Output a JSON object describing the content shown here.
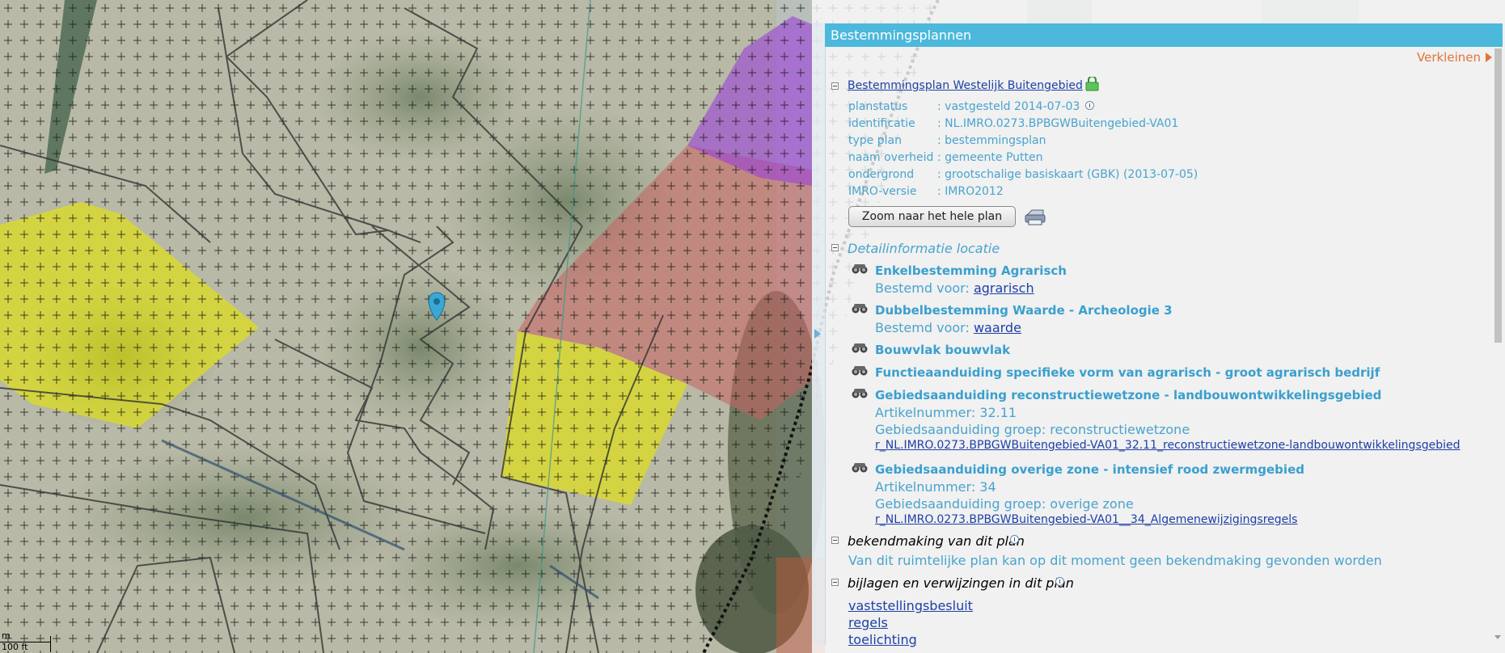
{
  "panel": {
    "title": "Bestemmingsplannen",
    "shrink_label": "Verkleinen"
  },
  "plan": {
    "name": "Bestemmingsplan Westelijk Buitengebied",
    "props": [
      {
        "label": "planstatus",
        "value": ": vastgesteld 2014-07-03"
      },
      {
        "label": "identificatie",
        "value": ": NL.IMRO.0273.BPBGWBuitengebied-VA01"
      },
      {
        "label": "type plan",
        "value": ": bestemmingsplan"
      },
      {
        "label": "naam overheid",
        "value": ": gemeente Putten"
      },
      {
        "label": "ondergrond",
        "value": ": grootschalige basiskaart (GBK) (2013-07-05)"
      },
      {
        "label": "IMRO-versie",
        "value": ": IMRO2012"
      }
    ],
    "zoom_button": "Zoom naar het hele plan"
  },
  "detail": {
    "heading": "Detailinformatie locatie",
    "items": [
      {
        "title": "Enkelbestemming Agrarisch",
        "prefix": "Bestemd voor:",
        "link": "agrarisch"
      },
      {
        "title": "Dubbelbestemming Waarde - Archeologie 3",
        "prefix": "Bestemd voor:",
        "link": "waarde"
      },
      {
        "title": "Bouwvlak bouwvlak"
      },
      {
        "title": "Functieaanduiding specifieke vorm van agrarisch - groot agrarisch bedrijf"
      },
      {
        "title": "Gebiedsaanduiding reconstructiewetzone - landbouwontwikkelingsgebied",
        "article": "Artikelnummer: 32.11",
        "group": "Gebiedsaanduiding groep: reconstructiewetzone",
        "link": "r_NL.IMRO.0273.BPBGWBuitengebied-VA01_32.11_reconstructiewetzone-landbouwontwikkelingsgebied"
      },
      {
        "title": "Gebiedsaanduiding overige zone - intensief rood zwermgebied",
        "article": "Artikelnummer: 34",
        "group": "Gebiedsaanduiding groep: overige zone",
        "link": "r_NL.IMRO.0273.BPBGWBuitengebied-VA01__34_Algemenewijzigingsregels"
      }
    ]
  },
  "announce": {
    "heading": "bekendmaking van dit plan",
    "text": "Van dit ruimtelijke plan kan op dit moment geen bekendmaking gevonden worden"
  },
  "attachments": {
    "heading": "bijlagen en verwijzingen in dit plan",
    "links": [
      "vaststellingsbesluit",
      "regels",
      "toelichting"
    ]
  },
  "scale": {
    "meters": "m",
    "feet": "100 ft"
  },
  "colors": {
    "header": "#4cb8dc",
    "accent_orange": "#e0743a",
    "yellow_zone": "#e6e600",
    "red_zone": "#c86060",
    "purple_zone": "#9a3fd8",
    "marker": "#3aa8d4"
  }
}
